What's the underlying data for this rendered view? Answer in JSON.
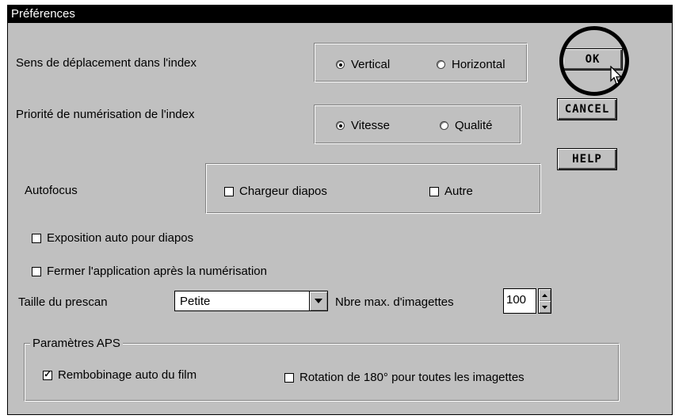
{
  "window": {
    "title": "Préférences"
  },
  "index_direction": {
    "label": "Sens de déplacement dans l'index",
    "options": [
      {
        "label": "Vertical",
        "selected": true
      },
      {
        "label": "Horizontal",
        "selected": false
      }
    ]
  },
  "index_priority": {
    "label": "Priorité de numérisation de l'index",
    "options": [
      {
        "label": "Vitesse",
        "selected": true
      },
      {
        "label": "Qualité",
        "selected": false
      }
    ]
  },
  "autofocus": {
    "label": "Autofocus",
    "options": [
      {
        "label": "Chargeur diapos",
        "checked": false
      },
      {
        "label": "Autre",
        "checked": false
      }
    ]
  },
  "auto_exposure": {
    "label": "Exposition auto pour diapos",
    "checked": false
  },
  "close_after_scan": {
    "label": "Fermer l'application après la numérisation",
    "checked": false
  },
  "prescan": {
    "label": "Taille du prescan",
    "value": "Petite"
  },
  "thumbnails": {
    "label": "Nbre max. d'imagettes",
    "value": "100"
  },
  "aps": {
    "legend": "Paramètres APS",
    "auto_rewind": {
      "label": "Rembobinage auto du film",
      "checked": true
    },
    "rotate": {
      "label": "Rotation de 180° pour toutes les imagettes",
      "checked": false
    }
  },
  "buttons": {
    "ok": "OK",
    "cancel": "CANCEL",
    "help": "HELP"
  }
}
